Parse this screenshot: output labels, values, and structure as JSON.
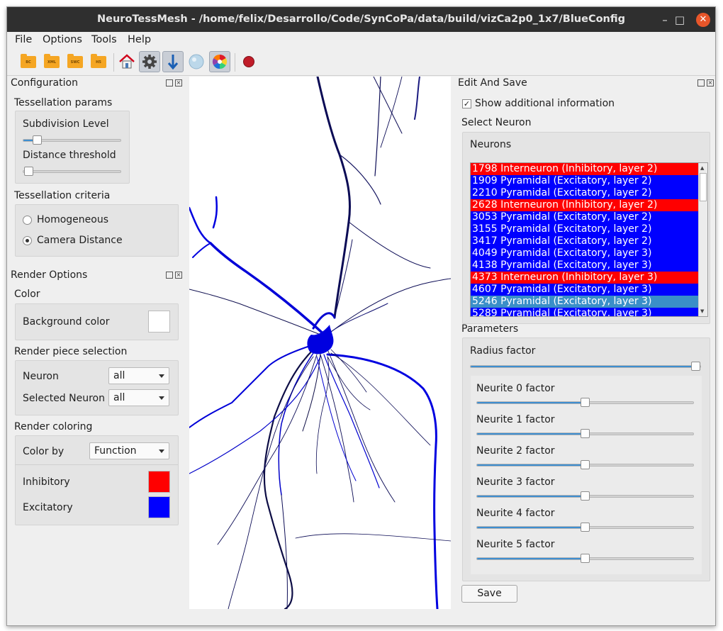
{
  "window": {
    "title": "NeuroTessMesh - /home/felix/Desarrollo/Code/SynCoPa/data/build/vizCa2p0_1x7/BlueConfig"
  },
  "titlebar_buttons": {
    "minimize": "–",
    "maximize": "□",
    "close": "✕"
  },
  "menu": [
    "File",
    "Options",
    "Tools",
    "Help"
  ],
  "toolbar": {
    "open_labels": [
      "BC",
      "XML",
      "SWC",
      "H5"
    ]
  },
  "configuration": {
    "title": "Configuration",
    "tessellation_params": {
      "title": "Tessellation params",
      "subdivision_label": "Subdivision Level",
      "subdivision_value": 0.12,
      "distance_label": "Distance threshold",
      "distance_value": 0.0
    },
    "tessellation_criteria": {
      "title": "Tessellation criteria",
      "options": [
        "Homogeneous",
        "Camera Distance"
      ],
      "selected": "Camera Distance"
    }
  },
  "render_options": {
    "title": "Render Options",
    "color_section": "Color",
    "background_label": "Background color",
    "background_color": "#ffffff",
    "piece_selection_title": "Render piece selection",
    "neuron_label": "Neuron",
    "neuron_value": "all",
    "selected_neuron_label": "Selected Neuron",
    "selected_neuron_value": "all",
    "coloring_title": "Render coloring",
    "color_by_label": "Color by",
    "color_by_value": "Function",
    "inhibitory_label": "Inhibitory",
    "inhibitory_color": "#ff0000",
    "excitatory_label": "Excitatory",
    "excitatory_color": "#0000ff"
  },
  "edit_and_save": {
    "title": "Edit And Save",
    "show_info_label": "Show additional information",
    "show_info_checked": true,
    "select_neuron_title": "Select Neuron",
    "neurons_label": "Neurons",
    "neurons": [
      {
        "text": "1798 Interneuron (Inhibitory, layer 2)",
        "type": "inhibitory"
      },
      {
        "text": "1909 Pyramidal (Excitatory, layer 2)",
        "type": "excitatory"
      },
      {
        "text": "2210 Pyramidal (Excitatory, layer 2)",
        "type": "excitatory"
      },
      {
        "text": "2628 Interneuron (Inhibitory, layer 2)",
        "type": "inhibitory"
      },
      {
        "text": "3053 Pyramidal (Excitatory, layer 2)",
        "type": "excitatory"
      },
      {
        "text": "3155 Pyramidal (Excitatory, layer 2)",
        "type": "excitatory"
      },
      {
        "text": "3417 Pyramidal (Excitatory, layer 2)",
        "type": "excitatory"
      },
      {
        "text": "4049 Pyramidal (Excitatory, layer 3)",
        "type": "excitatory"
      },
      {
        "text": "4138 Pyramidal (Excitatory, layer 3)",
        "type": "excitatory"
      },
      {
        "text": "4373 Interneuron (Inhibitory, layer 3)",
        "type": "inhibitory"
      },
      {
        "text": "4607 Pyramidal (Excitatory, layer 3)",
        "type": "excitatory"
      },
      {
        "text": "5246 Pyramidal (Excitatory, layer 3)",
        "type": "selected"
      },
      {
        "text": "5289 Pyramidal (Excitatory, layer 3)",
        "type": "excitatory"
      }
    ],
    "row_colors": {
      "inhibitory": "#ff0000",
      "excitatory": "#0000ff",
      "selected": "#3a8fc8"
    },
    "parameters_title": "Parameters",
    "radius_label": "Radius factor",
    "radius_value": 1.0,
    "neurite_factors": [
      {
        "label": "Neurite 0 factor",
        "value": 0.5
      },
      {
        "label": "Neurite 1 factor",
        "value": 0.5
      },
      {
        "label": "Neurite 2 factor",
        "value": 0.5
      },
      {
        "label": "Neurite 3 factor",
        "value": 0.5
      },
      {
        "label": "Neurite 4 factor",
        "value": 0.5
      },
      {
        "label": "Neurite 5 factor",
        "value": 0.5
      }
    ],
    "save_label": "Save"
  }
}
